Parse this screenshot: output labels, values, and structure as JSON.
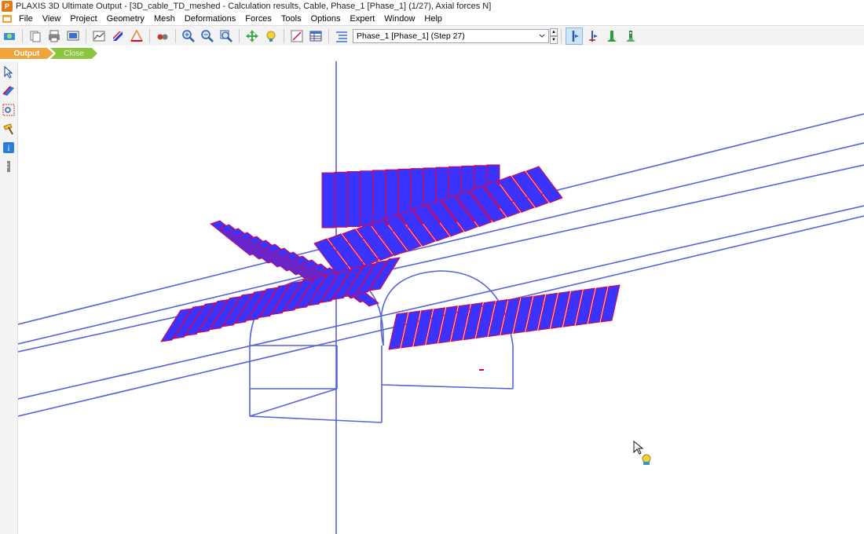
{
  "window": {
    "title": "PLAXIS 3D Ultimate Output - [3D_cable_TD_meshed - Calculation results, Cable, Phase_1 [Phase_1] (1/27), Axial forces N]"
  },
  "menu": [
    "File",
    "View",
    "Project",
    "Geometry",
    "Mesh",
    "Deformations",
    "Forces",
    "Tools",
    "Options",
    "Expert",
    "Window",
    "Help"
  ],
  "toolbar": {
    "phase_selected": "Phase_1 [Phase_1] (Step 27)"
  },
  "tabs": {
    "output": "Output",
    "close": "Close"
  },
  "colors": {
    "mesh_line": "#5563d6",
    "force_fill": "#3b33ff",
    "force_edge": "#e4003a",
    "output_tab": "#f0a43a",
    "close_tab": "#8cc63f"
  }
}
